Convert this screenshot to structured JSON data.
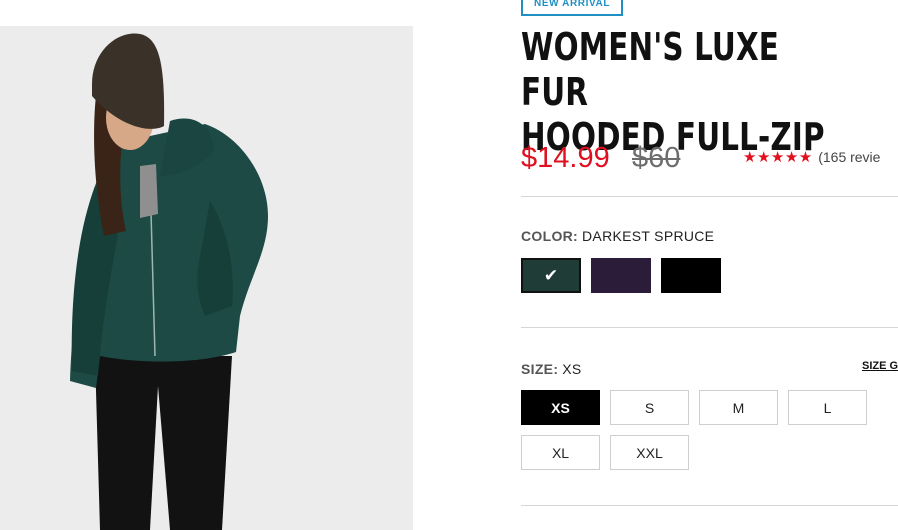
{
  "product": {
    "badge": "NEW ARRIVAL",
    "title_line1": "WOMEN'S LUXE FUR",
    "title_line2": "HOODED FULL-ZIP",
    "image_alt": "Woman wearing dark green hooded fur full-zip jacket"
  },
  "price": {
    "sale": "$14.99",
    "original": "$60"
  },
  "rating": {
    "stars": "★★★★★",
    "reviews": "(165 revie"
  },
  "color": {
    "label": "COLOR:",
    "selected": "DARKEST SPRUCE",
    "swatches": [
      {
        "name": "Darkest Spruce",
        "hex": "#1f3d36",
        "selected": true
      },
      {
        "name": "Purple",
        "hex": "#2b1d3a",
        "selected": false
      },
      {
        "name": "Black",
        "hex": "#000000",
        "selected": false
      }
    ]
  },
  "size": {
    "label": "SIZE:",
    "selected": "XS",
    "guide": "SIZE G",
    "options": [
      "XS",
      "S",
      "M",
      "L",
      "XL",
      "XXL"
    ]
  },
  "colors": {
    "sale_red": "#e01020",
    "badge_blue": "#1f8fc4",
    "image_bg": "#ececec"
  },
  "icons": {
    "check": "✔"
  }
}
